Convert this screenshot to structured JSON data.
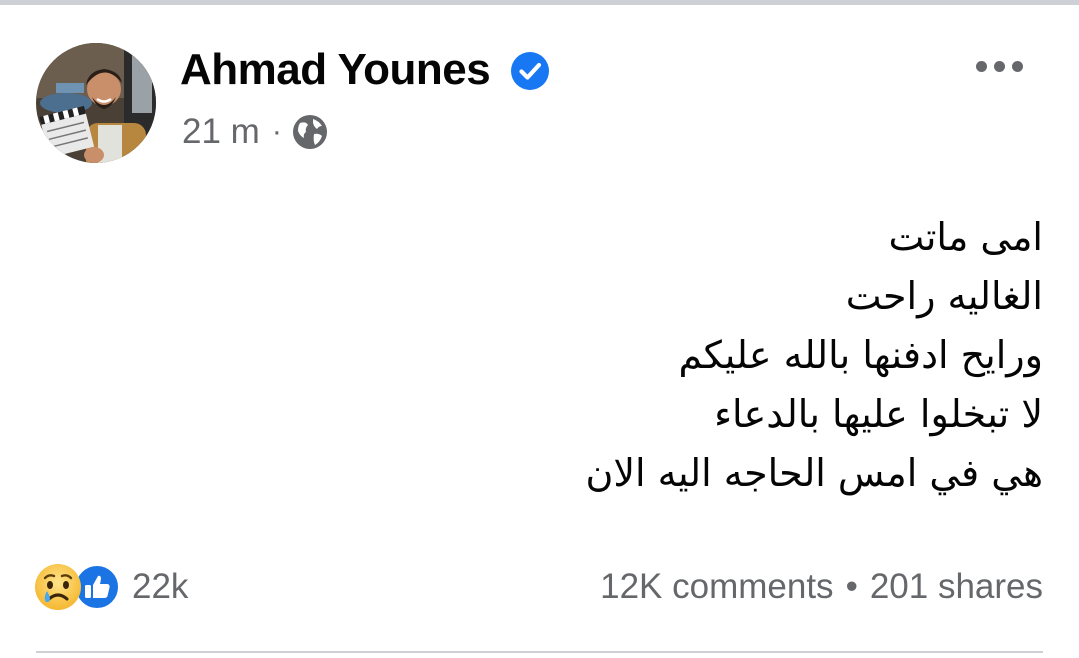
{
  "post": {
    "author": {
      "name": "Ahmad Younes",
      "verified": true,
      "avatar_icon": "profile-photo-man-with-clapperboard"
    },
    "time": "21 m",
    "meta_separator": "·",
    "privacy_icon": "globe-icon",
    "more_icon": "more-dots-icon",
    "text_lines": [
      "امى ماتت",
      "الغاليه راحت",
      "ورايح ادفنها بالله عليكم",
      "لا تبخلوا عليها بالدعاء",
      "هي في امس الحاجه اليه الان"
    ],
    "reactions": {
      "icons": [
        "sad-emoji-icon",
        "like-icon"
      ],
      "count": "22k"
    },
    "comments": "12K comments",
    "separator": "•",
    "shares": "201 shares"
  },
  "colors": {
    "verified_blue": "#1877f2",
    "secondary_text": "#65676b",
    "primary_text": "#050505"
  }
}
